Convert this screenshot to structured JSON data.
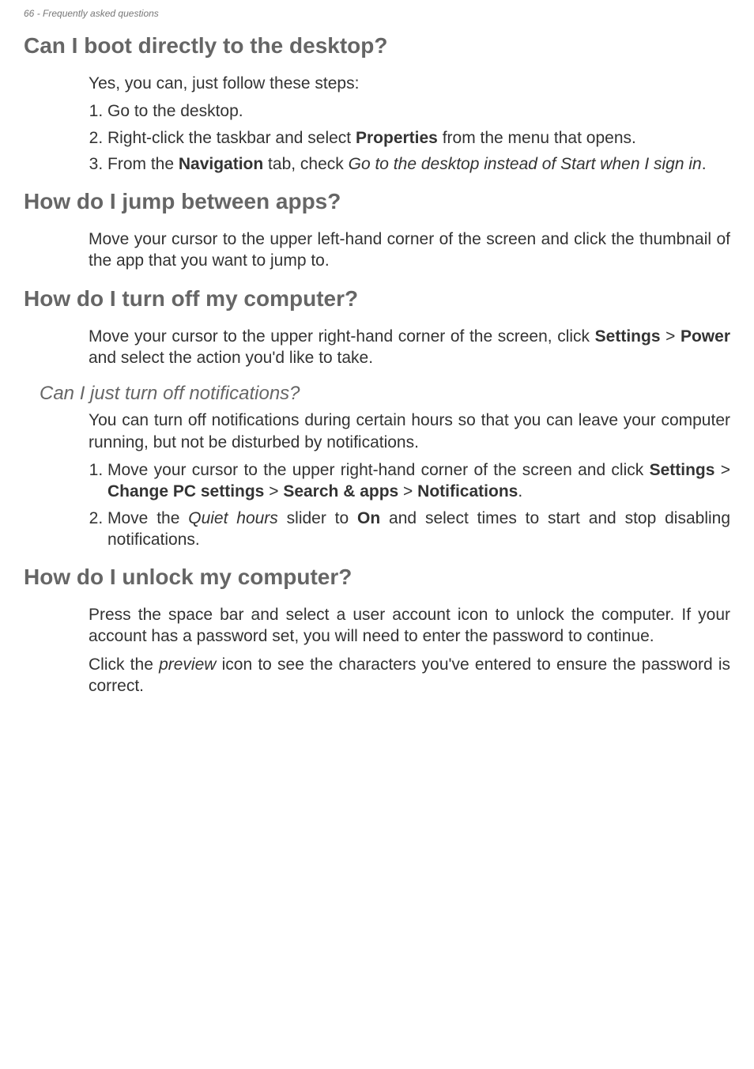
{
  "header": {
    "page_number": "66",
    "section_title": "Frequently asked questions"
  },
  "sections": {
    "boot": {
      "heading": "Can I boot directly to the desktop?",
      "intro": "Yes, you can, just follow these steps:",
      "step1": "Go to the desktop.",
      "step2_a": "Right-click the taskbar and select ",
      "step2_b": "Properties",
      "step2_c": " from the menu that opens.",
      "step3_a": "From the ",
      "step3_b": "Navigation",
      "step3_c": " tab, check ",
      "step3_d": "Go to the desktop instead of Start when I sign in",
      "step3_e": "."
    },
    "jump": {
      "heading": "How do I jump between apps?",
      "body": "Move your cursor to the upper left-hand corner of the screen and click the thumbnail of the app that you want to jump to."
    },
    "off": {
      "heading": "How do I turn off my computer?",
      "body_a": "Move your cursor to the upper right-hand corner of the screen, click ",
      "body_b": "Settings",
      "body_c": " > ",
      "body_d": "Power",
      "body_e": " and select the action you'd like to take."
    },
    "notif": {
      "heading": "Can I just turn off notifications?",
      "body": "You can turn off notifications during certain hours so that you can leave your computer running, but not be disturbed by notifications.",
      "step1_a": "Move your cursor to the upper right-hand corner of the screen and click ",
      "step1_b": "Settings",
      "step1_c": " > ",
      "step1_d": "Change PC settings",
      "step1_e": " > ",
      "step1_f": "Search & apps",
      "step1_g": " > ",
      "step1_h": "Notifications",
      "step1_i": ".",
      "step2_a": "Move the ",
      "step2_b": "Quiet hours",
      "step2_c": " slider to ",
      "step2_d": "On",
      "step2_e": " and select times to start and stop disabling notifications."
    },
    "unlock": {
      "heading": "How do I unlock my computer?",
      "body1": "Press the space bar and select a user account icon to unlock the computer. If your account has a password set, you will need to enter the password to continue.",
      "body2_a": "Click the ",
      "body2_b": "preview",
      "body2_c": " icon to see the characters you've entered to ensure the password is correct."
    }
  }
}
